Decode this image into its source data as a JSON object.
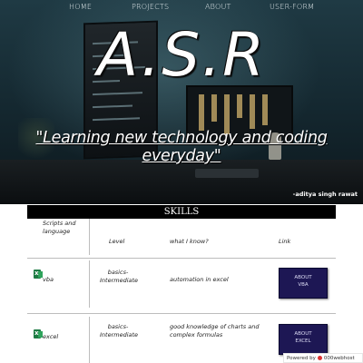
{
  "nav": {
    "items": [
      {
        "label": "HOME"
      },
      {
        "label": "PROJECTS"
      },
      {
        "label": "ABOUT"
      },
      {
        "label": "USER-FORM"
      }
    ]
  },
  "hero": {
    "title": "A.S.R",
    "tagline": "\"Learning new technology and coding everyday\"",
    "author": "-aditya singh rawat"
  },
  "skills": {
    "banner": "SKILLS",
    "headers": {
      "scripts": "Scripts and language",
      "level": "Level",
      "what": "what I know?",
      "link": "Link"
    },
    "rows": [
      {
        "icon": "excel-icon",
        "name": "vba",
        "level": "basics-Intermediate",
        "what": "automation in excel",
        "link_label_1": "ABOUT",
        "link_label_2": "VBA"
      },
      {
        "icon": "excel-icon",
        "name": "excel",
        "level": "basics-Intermediate",
        "what": "good knowledge of charts and complex formulas",
        "link_label_1": "ABOUT",
        "link_label_2": "EXCEL"
      }
    ]
  },
  "watermark": {
    "text": "Powered by",
    "brand": "000webhost"
  },
  "colors": {
    "button_bg": "#1d1754",
    "banner_bg": "#000000"
  }
}
